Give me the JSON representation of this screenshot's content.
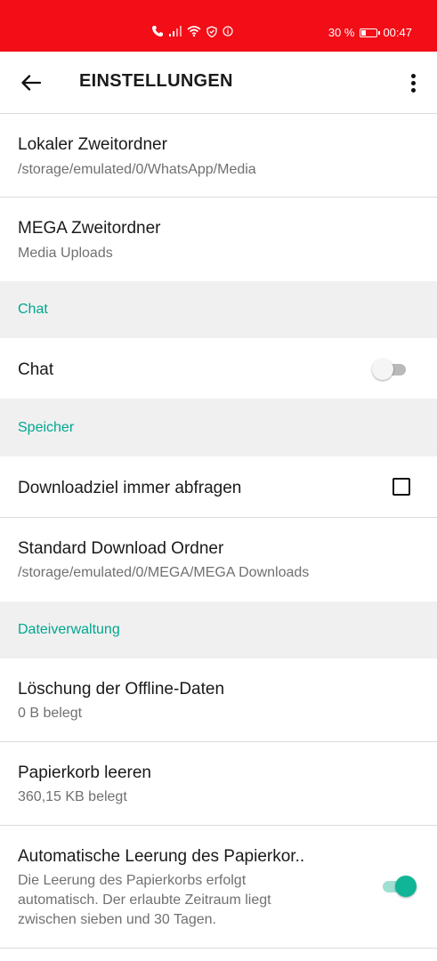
{
  "status_bar": {
    "battery_percent": "30 %",
    "battery_level": 0.3,
    "time": "00:47"
  },
  "app_bar": {
    "title": "EINSTELLUNGEN"
  },
  "settings": {
    "local_secondary_folder": {
      "title": "Lokaler Zweitordner",
      "value": "/storage/emulated/0/WhatsApp/Media"
    },
    "mega_secondary_folder": {
      "title": "MEGA Zweitordner",
      "value": "Media Uploads"
    },
    "section_chat": "Chat",
    "chat_toggle": {
      "title": "Chat",
      "enabled": false
    },
    "section_storage": "Speicher",
    "always_ask_download": {
      "title": "Downloadziel immer abfragen",
      "checked": false
    },
    "default_download_folder": {
      "title": "Standard Download Ordner",
      "value": "/storage/emulated/0/MEGA/MEGA Downloads"
    },
    "section_file_management": "Dateiverwaltung",
    "offline_data": {
      "title": "Löschung der Offline-Daten",
      "value": "0 B belegt"
    },
    "empty_trash": {
      "title": "Papierkorb leeren",
      "value": "360,15 KB belegt"
    },
    "auto_empty_trash": {
      "title": "Automatische Leerung des Papierkor..",
      "desc_line1": "Die Leerung des Papierkorbs erfolgt",
      "desc_line2": "automatisch. Der erlaubte Zeitraum liegt",
      "desc_line3": "zwischen sieben und 30 Tagen.",
      "enabled": true
    }
  },
  "colors": {
    "status_bar": "#f20d17",
    "accent": "#00a78f",
    "toggle_on": "#0fb596"
  }
}
